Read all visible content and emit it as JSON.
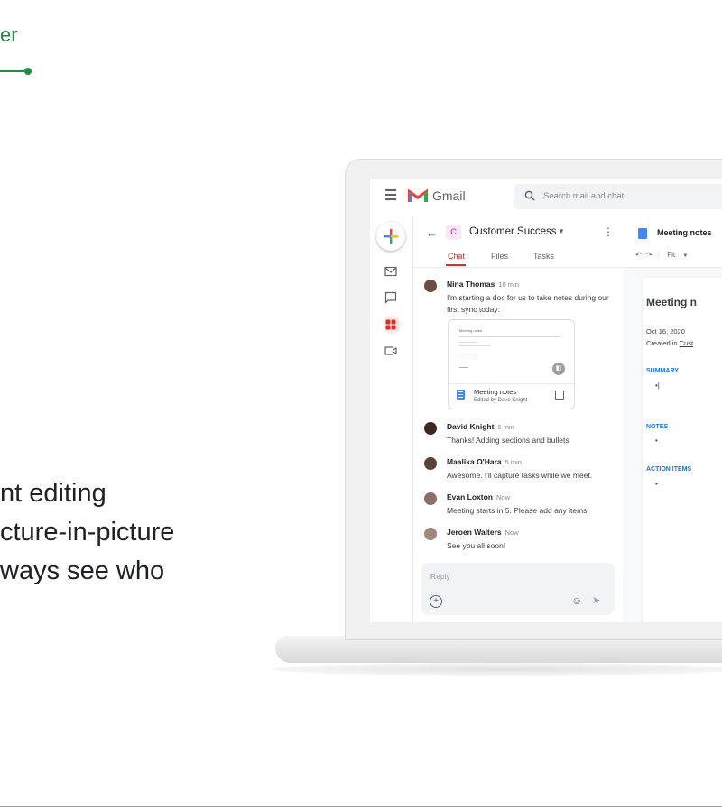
{
  "eyebrow": "er",
  "headline": {
    "line1": "nt editing",
    "line2": "cture-in-picture",
    "line3": "ways see who"
  },
  "gmail": {
    "app_name": "Gmail",
    "search_placeholder": "Search mail and chat"
  },
  "chat": {
    "room_initial": "C",
    "room_name": "Customer Success",
    "tabs": [
      "Chat",
      "Files",
      "Tasks"
    ],
    "active_tab": "Chat",
    "messages": [
      {
        "name": "Nina Thomas",
        "time": "10 min",
        "text": "I'm starting a doc for us to take notes during our first sync today:"
      },
      {
        "name": "David Knight",
        "time": "6 min",
        "text": "Thanks! Adding sections and bullets"
      },
      {
        "name": "Maalika O'Hara",
        "time": "5 min",
        "text": "Awesome. I'll capture tasks while we meet."
      },
      {
        "name": "Evan Loxton",
        "time": "Now",
        "text": "Meeting starts in 5. Please add any items!"
      },
      {
        "name": "Jeroen Walters",
        "time": "Now",
        "text": "See you all soon!"
      }
    ],
    "attachment": {
      "thumb_title": "Meeting notes",
      "name": "Meeting notes",
      "subtitle": "Edited by Dave Knight"
    },
    "reply_placeholder": "Reply"
  },
  "doc": {
    "title": "Meeting notes",
    "toolbar_zoom": "Fit",
    "heading": "Meeting n",
    "date": "Oct 16, 2020",
    "created_prefix": "Created in ",
    "created_link": "Cust",
    "sections": [
      "SUMMARY",
      "NOTES",
      "ACTION ITEMS"
    ]
  },
  "colors": {
    "accent_green": "#1e8e3e",
    "active_tab_red": "#d93025",
    "doc_blue": "#1a73e8"
  }
}
